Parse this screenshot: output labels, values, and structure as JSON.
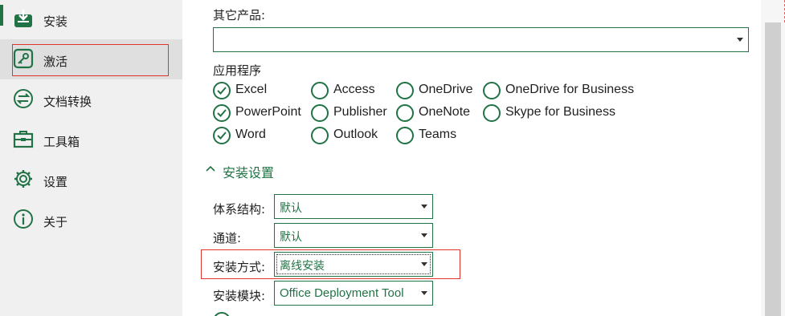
{
  "sidebar": {
    "items": [
      {
        "label": "安装",
        "icon": "install-icon"
      },
      {
        "label": "激活",
        "icon": "key-icon",
        "selected": true
      },
      {
        "label": "文档转换",
        "icon": "convert-icon"
      },
      {
        "label": "工具箱",
        "icon": "toolbox-icon"
      },
      {
        "label": "设置",
        "icon": "gear-icon"
      },
      {
        "label": "关于",
        "icon": "info-icon"
      }
    ]
  },
  "main": {
    "other_products": {
      "label": "其它产品:",
      "value": ""
    },
    "apps": {
      "label": "应用程序",
      "items": [
        {
          "name": "Excel",
          "checked": true
        },
        {
          "name": "Access",
          "checked": false
        },
        {
          "name": "OneDrive",
          "checked": false
        },
        {
          "name": "OneDrive for Business",
          "checked": false
        },
        {
          "name": "PowerPoint",
          "checked": true
        },
        {
          "name": "Publisher",
          "checked": false
        },
        {
          "name": "OneNote",
          "checked": false
        },
        {
          "name": "Skype for Business",
          "checked": false
        },
        {
          "name": "Word",
          "checked": true
        },
        {
          "name": "Outlook",
          "checked": false
        },
        {
          "name": "Teams",
          "checked": false
        }
      ]
    },
    "install_settings": {
      "header": "安装设置",
      "fields": [
        {
          "label": "体系结构:",
          "value": "默认"
        },
        {
          "label": "通道:",
          "value": "默认"
        },
        {
          "label": "安装方式:",
          "value": "离线安装"
        },
        {
          "label": "安装模块:",
          "value": "Office Deployment Tool"
        }
      ]
    }
  },
  "colors": {
    "accent": "#217346",
    "sidebar_bg": "#f0f0f0",
    "selected_bg": "#dfdfdf",
    "highlight_box": "#e0342c"
  }
}
